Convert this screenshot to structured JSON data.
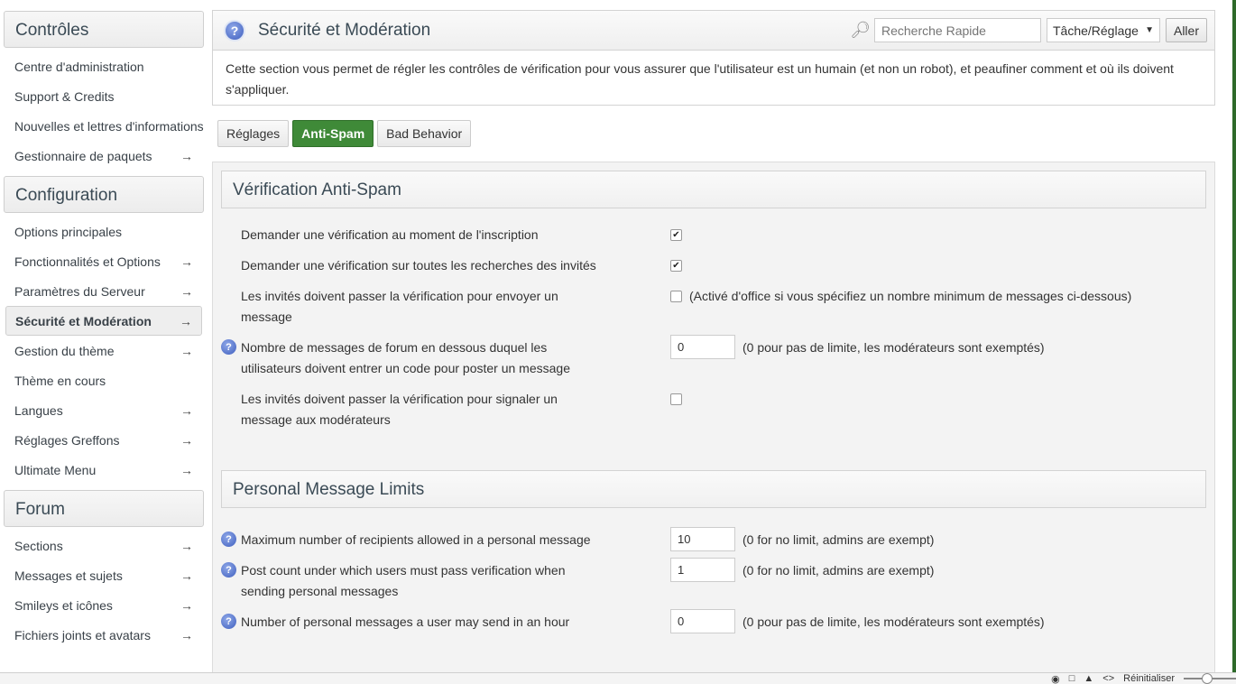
{
  "sidebar": {
    "sections": [
      {
        "title": "Contrôles",
        "items": [
          {
            "label": "Centre d'administration",
            "arrow": ""
          },
          {
            "label": "Support & Credits",
            "arrow": ""
          },
          {
            "label": "Nouvelles et lettres d'informations",
            "arrow": ""
          },
          {
            "label": "Gestionnaire de paquets",
            "arrow": "→"
          }
        ]
      },
      {
        "title": "Configuration",
        "items": [
          {
            "label": "Options principales",
            "arrow": ""
          },
          {
            "label": "Fonctionnalités et Options",
            "arrow": "→"
          },
          {
            "label": "Paramètres du Serveur",
            "arrow": "→"
          },
          {
            "label": "Sécurité et Modération",
            "arrow": "→"
          },
          {
            "label": "Gestion du thème",
            "arrow": "→"
          },
          {
            "label": "Thème en cours",
            "arrow": ""
          },
          {
            "label": "Langues",
            "arrow": "→"
          },
          {
            "label": "Réglages Greffons",
            "arrow": "→"
          },
          {
            "label": "Ultimate Menu",
            "arrow": "→"
          }
        ]
      },
      {
        "title": "Forum",
        "items": [
          {
            "label": "Sections",
            "arrow": "→"
          },
          {
            "label": "Messages et sujets",
            "arrow": "→"
          },
          {
            "label": "Smileys et icônes",
            "arrow": "→"
          },
          {
            "label": "Fichiers joints et avatars",
            "arrow": "→"
          }
        ]
      }
    ]
  },
  "header": {
    "title": "Sécurité et Modération",
    "help_glyph": "?",
    "search_placeholder": "Recherche Rapide",
    "select_value": "Tâche/Réglage",
    "go_label": "Aller",
    "description": "Cette section vous permet de régler les contrôles de vérification pour vous assurer que l'utilisateur est un humain (et non un robot), et peaufiner comment et où ils doivent s'appliquer."
  },
  "tabs": [
    {
      "label": "Réglages",
      "active": false
    },
    {
      "label": "Anti-Spam",
      "active": true
    },
    {
      "label": "Bad Behavior",
      "active": false
    }
  ],
  "antispam": {
    "title": "Vérification Anti-Spam",
    "rows": [
      {
        "label": "Demander une vérification au moment de l'inscription",
        "checked": true,
        "note": ""
      },
      {
        "label": "Demander une vérification sur toutes les recherches des invités",
        "checked": true,
        "note": ""
      },
      {
        "label": "Les invités doivent passer la vérification pour envoyer un message",
        "checked": false,
        "note": "(Activé d'office si vous spécifiez un nombre minimum de messages ci-dessous)"
      },
      {
        "label": "Nombre de messages de forum en dessous duquel les utilisateurs doivent entrer un code pour poster un message",
        "value": "0",
        "note": "(0 pour pas de limite, les modérateurs sont exemptés)"
      },
      {
        "label": "Les invités doivent passer la vérification pour signaler un message aux modérateurs",
        "checked": false,
        "note": ""
      }
    ]
  },
  "pm_limits": {
    "title": "Personal Message Limits",
    "rows": [
      {
        "label": "Maximum number of recipients allowed in a personal message",
        "value": "10",
        "note": "(0 for no limit, admins are exempt)"
      },
      {
        "label": "Post count under which users must pass verification when sending personal messages",
        "value": "1",
        "note": "(0 for no limit, admins are exempt)"
      },
      {
        "label": "Number of personal messages a user may send in an hour",
        "value": "0",
        "note": "(0 pour pas de limite, les modérateurs sont exemptés)"
      }
    ]
  },
  "statusbar": {
    "reset_label": "Réinitialiser"
  }
}
